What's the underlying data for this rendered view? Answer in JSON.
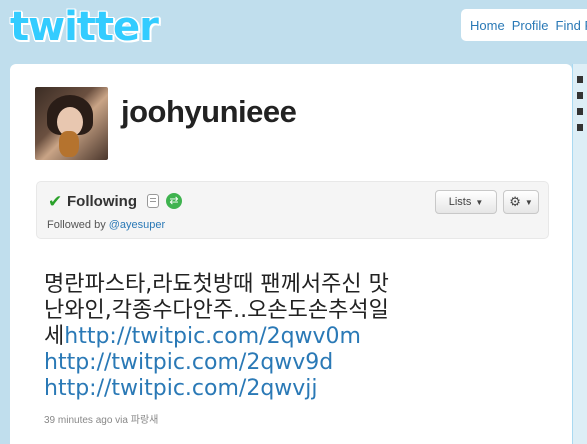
{
  "brand": {
    "logo_text": "twitter"
  },
  "topnav": {
    "items": [
      "Home",
      "Profile",
      "Find P"
    ]
  },
  "profile": {
    "username": "joohyunieee",
    "following_label": "Following",
    "followed_by_prefix": "Followed by",
    "followed_by_user": "@ayesuper",
    "lists_button": "Lists"
  },
  "tweet": {
    "text_lines": [
      "명란파스타,라됴첫방때 팬께서주신 맛",
      "난와인,각종수다안주..오손도손추석일",
      "세"
    ],
    "urls": [
      "http://twitpic.com/2qwv0m",
      "http://twitpic.com/2qwv9d",
      "http://twitpic.com/2qwvjj"
    ],
    "time": "39 minutes ago",
    "via_label": "via",
    "via_source": "파랑새"
  },
  "colors": {
    "background": "#c0deed",
    "link": "#2a79b6",
    "logo": "#33ccff"
  }
}
